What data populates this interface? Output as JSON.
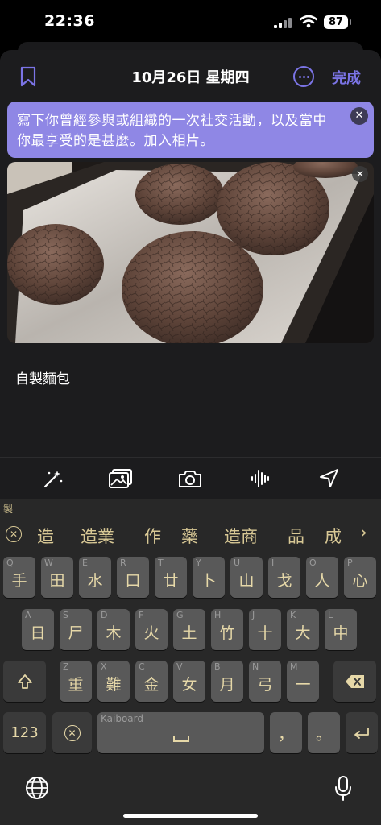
{
  "status": {
    "time": "22:36",
    "battery": "87"
  },
  "nav": {
    "date": "10月26日 星期四",
    "done_label": "完成"
  },
  "prompt": {
    "text": "寫下你曾經參與或組織的一次社交活動，以及當中你最享受的是甚麼。加入相片。"
  },
  "entry": {
    "text": "自製麵包"
  },
  "toolbar": {
    "icons": [
      "magic-wand-icon",
      "photo-library-icon",
      "camera-icon",
      "audio-waveform-icon",
      "location-arrow-icon"
    ]
  },
  "keyboard": {
    "composition": "製",
    "candidates": [
      "造",
      "造業",
      "作",
      "藥",
      "造商",
      "品",
      "成"
    ],
    "row1": [
      {
        "hint": "Q",
        "glyph": "手"
      },
      {
        "hint": "W",
        "glyph": "田"
      },
      {
        "hint": "E",
        "glyph": "水"
      },
      {
        "hint": "R",
        "glyph": "口"
      },
      {
        "hint": "T",
        "glyph": "廿"
      },
      {
        "hint": "Y",
        "glyph": "卜"
      },
      {
        "hint": "U",
        "glyph": "山"
      },
      {
        "hint": "I",
        "glyph": "戈"
      },
      {
        "hint": "O",
        "glyph": "人"
      },
      {
        "hint": "P",
        "glyph": "心"
      }
    ],
    "row2": [
      {
        "hint": "A",
        "glyph": "日"
      },
      {
        "hint": "S",
        "glyph": "尸"
      },
      {
        "hint": "D",
        "glyph": "木"
      },
      {
        "hint": "F",
        "glyph": "火"
      },
      {
        "hint": "G",
        "glyph": "土"
      },
      {
        "hint": "H",
        "glyph": "竹"
      },
      {
        "hint": "J",
        "glyph": "十"
      },
      {
        "hint": "K",
        "glyph": "大"
      },
      {
        "hint": "L",
        "glyph": "中"
      }
    ],
    "row3": [
      {
        "hint": "Z",
        "glyph": "重"
      },
      {
        "hint": "X",
        "glyph": "難"
      },
      {
        "hint": "C",
        "glyph": "金"
      },
      {
        "hint": "V",
        "glyph": "女"
      },
      {
        "hint": "B",
        "glyph": "月"
      },
      {
        "hint": "N",
        "glyph": "弓"
      },
      {
        "hint": "M",
        "glyph": "一"
      }
    ],
    "numbers_label": "123",
    "space_brand": "Kaiboard",
    "comma": "，",
    "period": "。"
  },
  "colors": {
    "accent": "#7b74e6",
    "prompt_bg": "#8f87e5",
    "key_text": "#e6d8a8"
  }
}
